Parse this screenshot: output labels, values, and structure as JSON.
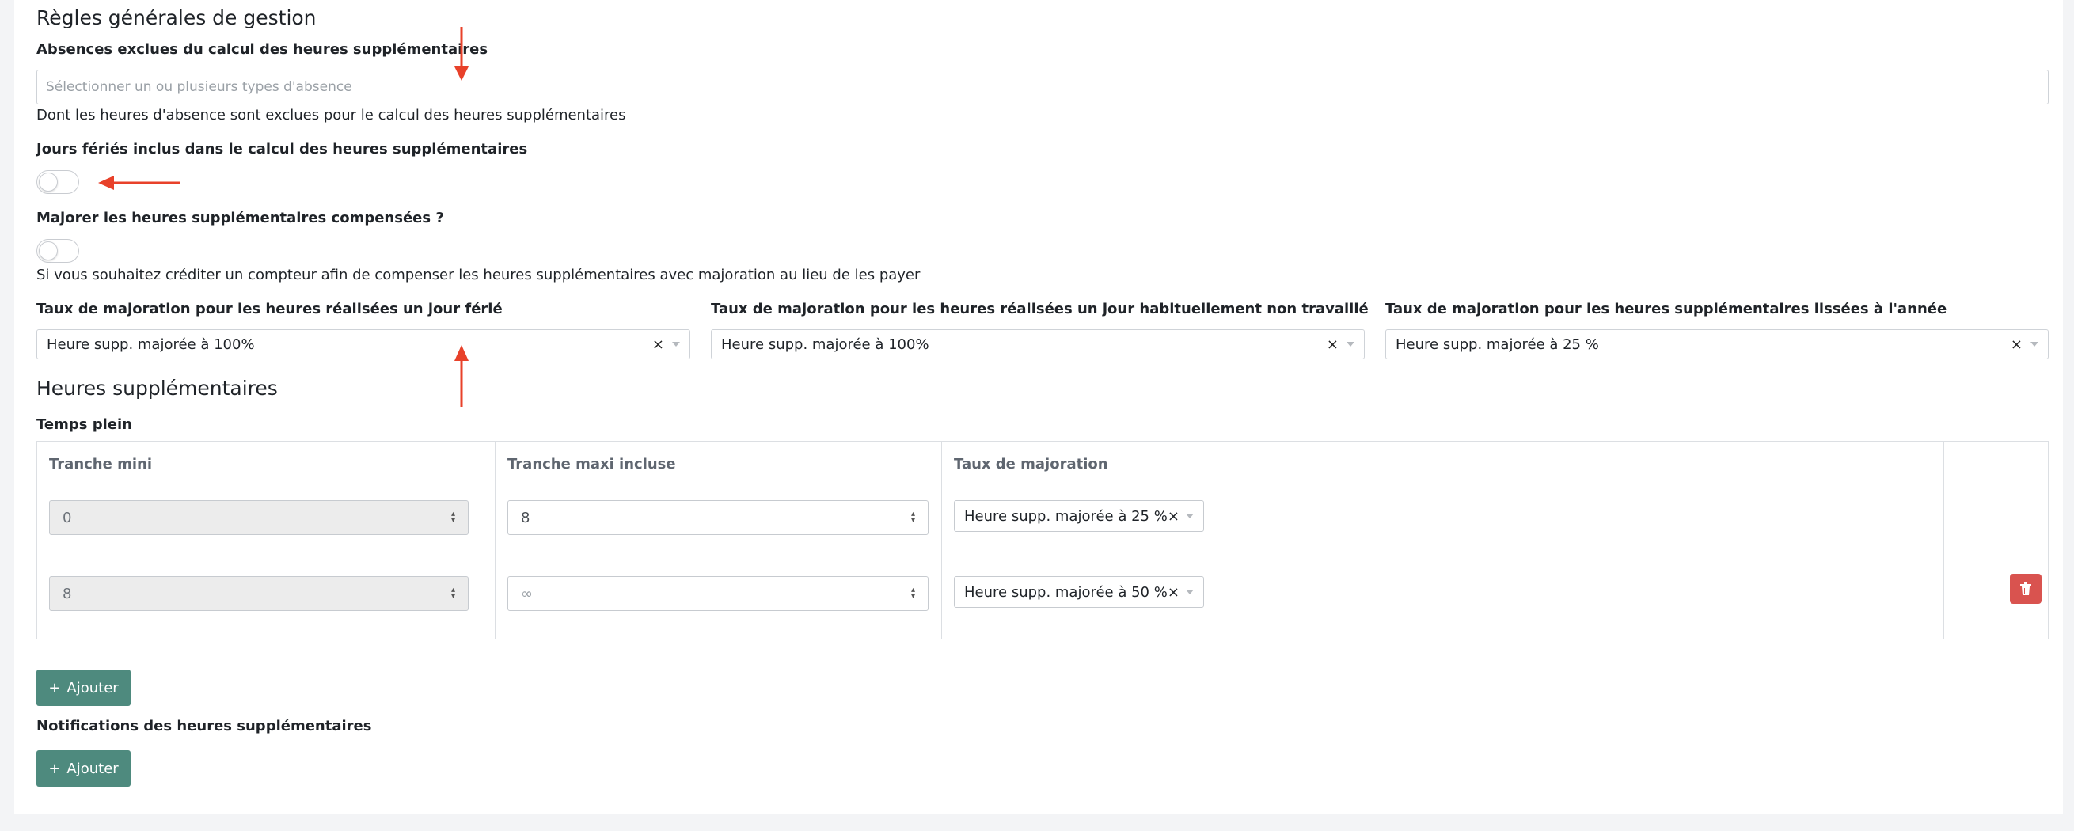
{
  "general": {
    "title": "Règles générales de gestion",
    "absences_label": "Absences exclues du calcul des heures supplémentaires",
    "absences_placeholder": "Sélectionner un ou plusieurs types d'absence",
    "absences_help": "Dont les heures d'absence sont exclues pour le calcul des heures supplémentaires",
    "holidays_label": "Jours fériés inclus dans le calcul des heures supplémentaires",
    "holidays_toggle_on": false,
    "compensated_label": "Majorer les heures supplémentaires compensées ?",
    "compensated_toggle_on": false,
    "compensated_help": "Si vous souhaitez créditer un compteur afin de compenser les heures supplémentaires avec majoration au lieu de les payer",
    "rates": [
      {
        "label": "Taux de majoration pour les heures réalisées un jour férié",
        "value": "Heure supp. majorée à 100%"
      },
      {
        "label": "Taux de majoration pour les heures réalisées un jour habituellement non travaillé",
        "value": "Heure supp. majorée à 100%"
      },
      {
        "label": "Taux de majoration pour les heures supplémentaires lissées à l'année",
        "value": "Heure supp. majorée à 25 %"
      }
    ]
  },
  "overtime": {
    "title": "Heures supplémentaires",
    "subtitle": "Temps plein",
    "columns": [
      "Tranche mini",
      "Tranche maxi incluse",
      "Taux de majoration",
      ""
    ],
    "rows": [
      {
        "min": "0",
        "max": "8",
        "rate": "Heure supp. majorée à 25 %"
      },
      {
        "min": "8",
        "max": "∞",
        "rate": "Heure supp. majorée à 50 %"
      }
    ],
    "add_label": "Ajouter"
  },
  "notifications": {
    "title": "Notifications des heures supplémentaires",
    "add_label": "Ajouter"
  },
  "icons": {
    "clear": "×",
    "plus": "+",
    "trash": "trash-icon"
  },
  "colors": {
    "accent": "#4e8a7e",
    "danger": "#d9534f",
    "annotation": "#e8412a"
  }
}
